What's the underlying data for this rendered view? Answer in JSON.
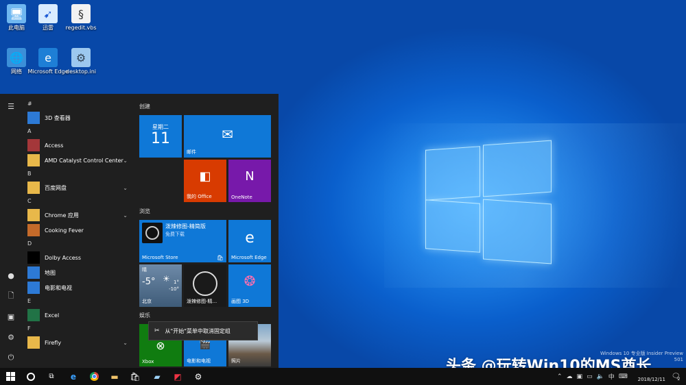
{
  "desktop": {
    "icons": [
      {
        "label": "此电脑"
      },
      {
        "label": "迅雷"
      },
      {
        "label": "regedit.vbs"
      },
      {
        "label": "网络"
      },
      {
        "label": "Microsoft Edge"
      },
      {
        "label": "desktop.ini"
      }
    ],
    "watermark": [
      "Windows 10 专业版 Insider Preview",
      "501"
    ],
    "brand": "头条 @玩转Win10的MS酋长"
  },
  "start_menu": {
    "sections": [
      {
        "letter": "#",
        "apps": [
          {
            "label": "3D 查看器",
            "icon": "cube-icon",
            "color": "#2d7ad6"
          }
        ]
      },
      {
        "letter": "A",
        "apps": [
          {
            "label": "Access",
            "icon": "access-icon",
            "color": "#a4373a"
          },
          {
            "label": "AMD Catalyst Control Center",
            "icon": "folder-icon",
            "color": "#e8b84a",
            "expand": true
          }
        ]
      },
      {
        "letter": "B",
        "apps": [
          {
            "label": "百度网盘",
            "icon": "folder-icon",
            "color": "#e8b84a",
            "expand": true
          }
        ]
      },
      {
        "letter": "C",
        "apps": [
          {
            "label": "Chrome 应用",
            "icon": "folder-icon",
            "color": "#e8b84a",
            "expand": true
          },
          {
            "label": "Cooking Fever",
            "icon": "cooking-icon",
            "color": "#c46a2a"
          }
        ]
      },
      {
        "letter": "D",
        "apps": [
          {
            "label": "Dolby Access",
            "icon": "dolby-icon",
            "color": "#000000"
          },
          {
            "label": "地图",
            "icon": "maps-icon",
            "color": "#2d7ad6"
          },
          {
            "label": "电影和电视",
            "icon": "movies-icon",
            "color": "#2d7ad6"
          }
        ]
      },
      {
        "letter": "E",
        "apps": [
          {
            "label": "Excel",
            "icon": "excel-icon",
            "color": "#217346"
          }
        ]
      },
      {
        "letter": "F",
        "apps": [
          {
            "label": "Firefly",
            "icon": "folder-icon",
            "color": "#e8b84a",
            "expand": true
          }
        ]
      }
    ],
    "groups": {
      "create": "创建",
      "browse": "浏览",
      "entertain": "娱乐"
    },
    "tiles": {
      "calendar": {
        "day": "星期二",
        "date": "11"
      },
      "mail": {
        "label": "邮件"
      },
      "office": {
        "label": "我的 Office"
      },
      "onenote": {
        "label": "OneNote"
      },
      "store": {
        "title": "泼辣修图-精简版",
        "sub": "免费下载",
        "label": "Microsoft Store"
      },
      "edge": {
        "label": "Microsoft Edge"
      },
      "weather": {
        "cond": "晴",
        "temp": "-5°",
        "hi": "1°",
        "lo": "-10°",
        "city": "北京"
      },
      "polarr": {
        "label": "泼辣修图-精..."
      },
      "paint3d": {
        "label": "画图 3D"
      },
      "xbox": {
        "label": "Xbox"
      },
      "movies": {
        "label": "电影和电视"
      },
      "photos": {
        "label": "照片"
      }
    },
    "context_menu": {
      "unpin_group": "从\"开始\"菜单中取消固定组"
    }
  },
  "taskbar": {
    "ime": "中",
    "date": "2018/12/11",
    "notifications": "2"
  }
}
